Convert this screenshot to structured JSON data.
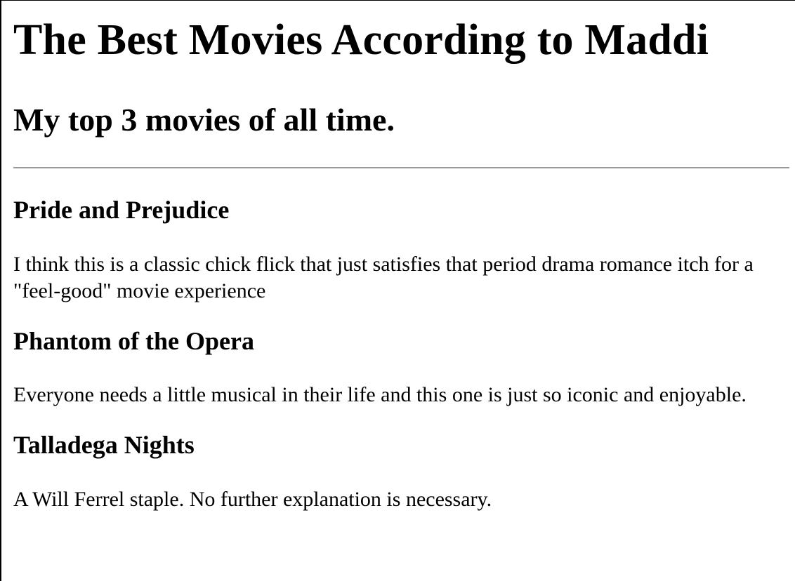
{
  "header": {
    "title": "The Best Movies According to Maddi",
    "subtitle": "My top 3 movies of all time."
  },
  "movies": [
    {
      "title": "Pride and Prejudice",
      "description": "I think this is a classic chick flick that just satisfies that period drama romance itch for a \"feel-good\" movie experience"
    },
    {
      "title": "Phantom of the Opera",
      "description": "Everyone needs a little musical in their life and this one is just so iconic and enjoyable."
    },
    {
      "title": "Talladega Nights",
      "description": "A Will Ferrel staple. No further explanation is necessary."
    }
  ]
}
